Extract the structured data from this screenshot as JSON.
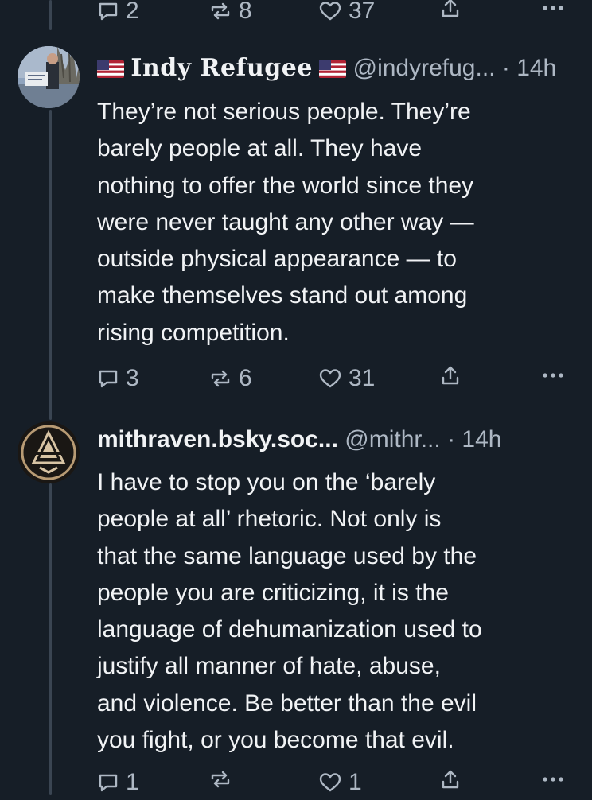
{
  "top_actions": {
    "replies": "2",
    "reposts": "8",
    "likes": "37"
  },
  "posts": [
    {
      "display_name": "Indy Refugee",
      "handle": "@indyrefug...",
      "separator": "·",
      "time": "14h",
      "lines": [
        "They’re not serious people. They’re",
        "barely people at all. They have",
        "nothing to offer the world since they",
        "were never taught any other way —",
        "outside physical appearance —  to",
        "make themselves stand out among",
        "rising competition."
      ],
      "replies": "3",
      "reposts": "6",
      "likes": "31"
    },
    {
      "display_name": "mithraven.bsky.soc...",
      "handle": "@mithr...",
      "separator": "·",
      "time": "14h",
      "lines": [
        "I have to stop you on the ‘barely",
        "people at all’ rhetoric. Not only is",
        "that the same language used by the",
        "people you are criticizing, it is the",
        "language of dehumanization used to",
        "justify all manner of hate, abuse,",
        "and violence. Be better than the evil",
        "you fight, or you become that evil."
      ],
      "replies": "1",
      "reposts": "",
      "likes": "1"
    }
  ],
  "colors": {
    "background": "#161e27",
    "text": "#f1f3f5",
    "muted": "#aeb8c4",
    "thread": "#3a4552"
  }
}
